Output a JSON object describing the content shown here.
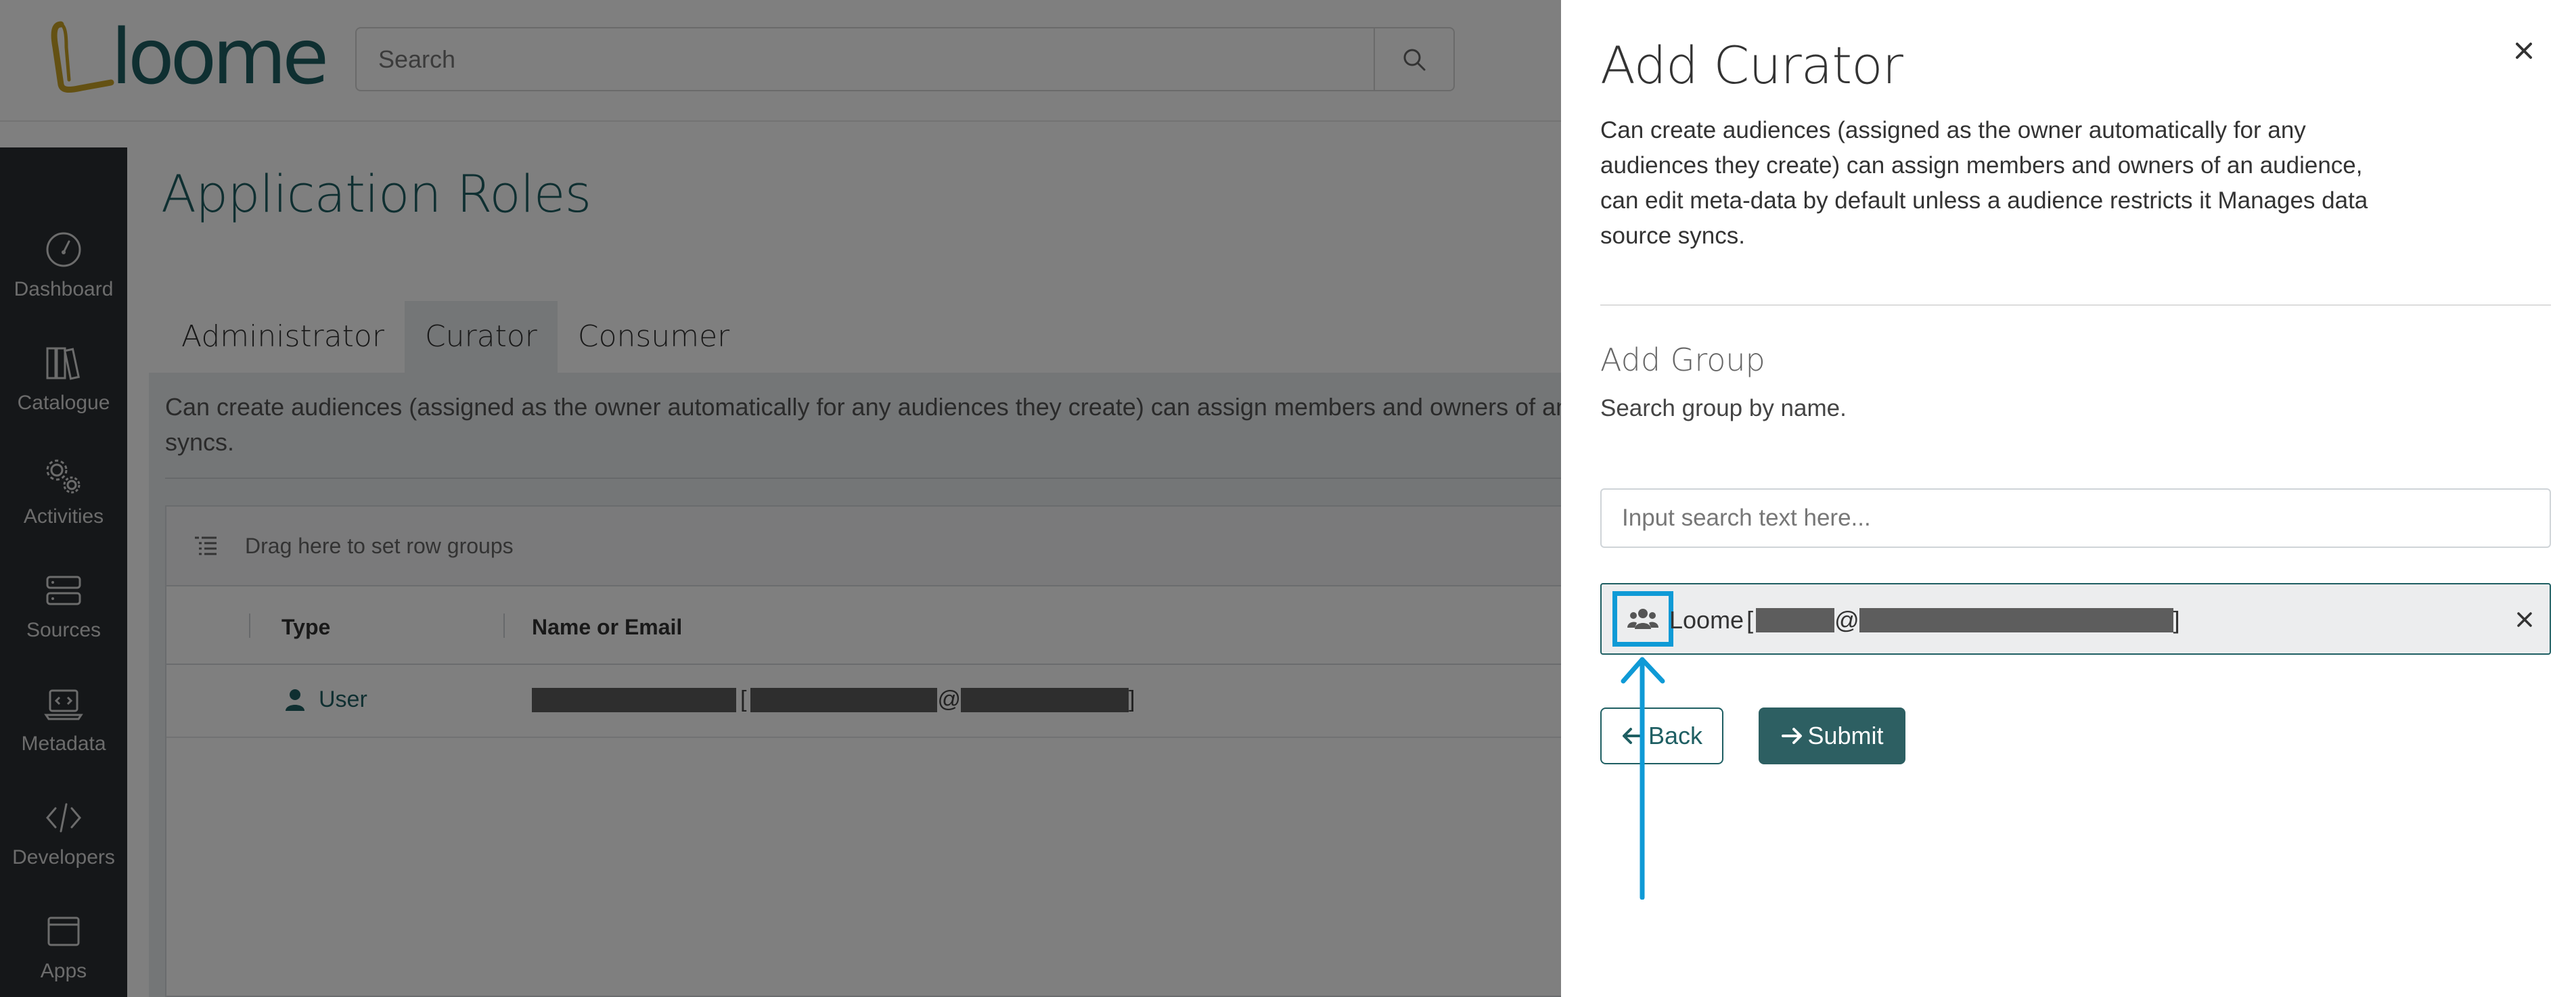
{
  "app": {
    "logo_text": "loome",
    "search_placeholder": "Search"
  },
  "sidebar": {
    "items": [
      {
        "label": "Dashboard",
        "icon": "dashboard-icon"
      },
      {
        "label": "Catalogue",
        "icon": "catalogue-icon"
      },
      {
        "label": "Activities",
        "icon": "activities-icon"
      },
      {
        "label": "Sources",
        "icon": "sources-icon"
      },
      {
        "label": "Metadata",
        "icon": "metadata-icon"
      },
      {
        "label": "Developers",
        "icon": "developers-icon"
      },
      {
        "label": "Apps",
        "icon": "apps-icon"
      }
    ]
  },
  "main": {
    "title": "Application Roles",
    "tabs": [
      {
        "label": "Administrator"
      },
      {
        "label": "Curator"
      },
      {
        "label": "Consumer"
      }
    ],
    "description": "Can create audiences (assigned as the owner automatically for any audiences they create) can assign members and owners of an a\nsyncs.",
    "grid": {
      "group_hint": "Drag here to set row groups",
      "columns": [
        "Type",
        "Name or Email"
      ],
      "rows": [
        {
          "type": "User",
          "name_open_bracket": "[",
          "name_at": "@",
          "name_close_bracket": "]"
        }
      ]
    }
  },
  "panel": {
    "title": "Add Curator",
    "description": "Can create audiences (assigned as the owner automatically for any audiences they create) can assign members and owners of an audience, can edit meta-data by default unless a audience restricts it Manages data source syncs.",
    "section_title": "Add Group",
    "section_hint": "Search group by name.",
    "search_placeholder": "Input search text here...",
    "selected_group": {
      "name": "Loome",
      "open_bracket": "[",
      "at": "@",
      "close_bracket": "]"
    },
    "back_label": "Back",
    "submit_label": "Submit"
  },
  "colors": {
    "brand": "#1f5f63",
    "submit_bg": "#2d5f62",
    "annotation": "#0f9ad6",
    "sidebar_bg": "#2b2f33"
  }
}
